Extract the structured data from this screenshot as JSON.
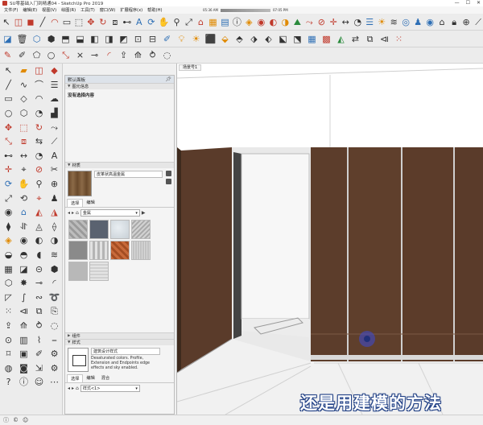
{
  "window": {
    "title": "SU零基础入门到精通04 - SketchUp Pro 2019",
    "controls": [
      "—",
      "☐",
      "✕"
    ]
  },
  "menu": [
    "文件(F)",
    "编辑(E)",
    "视图(V)",
    "绘图(R)",
    "工具(T)",
    "窗口(W)",
    "扩展程序(x)",
    "帮助(H)"
  ],
  "timebar": {
    "start": "05:36 AM",
    "end": "07:05 PM"
  },
  "toolbar": {
    "row1": [
      {
        "name": "select-icon",
        "glyph": "↖",
        "tone": ""
      },
      {
        "name": "eraser-icon",
        "glyph": "◫",
        "tone": "a"
      },
      {
        "name": "paint-bucket-icon",
        "glyph": "◼",
        "tone": "a"
      },
      {
        "name": "line-icon",
        "glyph": "╱",
        "tone": ""
      },
      {
        "name": "arc-icon",
        "glyph": "◠",
        "tone": "a"
      },
      {
        "name": "rectangle-icon",
        "glyph": "▭",
        "tone": ""
      },
      {
        "name": "push-pull-icon",
        "glyph": "⬚",
        "tone": ""
      },
      {
        "name": "move-icon",
        "glyph": "✥",
        "tone": "a"
      },
      {
        "name": "rotate-icon",
        "glyph": "↻",
        "tone": "a"
      },
      {
        "name": "offset-icon",
        "glyph": "⧈",
        "tone": ""
      },
      {
        "name": "tape-icon",
        "glyph": "⊷",
        "tone": ""
      },
      {
        "name": "text-icon",
        "glyph": "A",
        "tone": "b"
      },
      {
        "name": "orbit-icon",
        "glyph": "⟳",
        "tone": "b"
      },
      {
        "name": "pan-icon",
        "glyph": "✋",
        "tone": ""
      },
      {
        "name": "zoom-icon",
        "glyph": "⚲",
        "tone": ""
      },
      {
        "name": "zoom-extents-icon",
        "glyph": "⤢",
        "tone": ""
      },
      {
        "name": "warehouse-icon",
        "glyph": "⌂",
        "tone": "a"
      },
      {
        "name": "extension-icon",
        "glyph": "▦",
        "tone": "c"
      },
      {
        "name": "layout-icon",
        "glyph": "▤",
        "tone": "b"
      },
      {
        "name": "model-info-icon",
        "glyph": "ⓘ",
        "tone": ""
      },
      {
        "name": "solid-union-icon",
        "glyph": "◈",
        "tone": "c"
      },
      {
        "name": "solid-subtract-icon",
        "glyph": "◉",
        "tone": "a"
      },
      {
        "name": "solid-trim-icon",
        "glyph": "◐",
        "tone": "a"
      },
      {
        "name": "solid-split-icon",
        "glyph": "◑",
        "tone": "c"
      },
      {
        "name": "sandbox-icon",
        "glyph": "⛰",
        "tone": "d"
      },
      {
        "name": "follow-icon",
        "glyph": "⤳",
        "tone": "a"
      },
      {
        "name": "section-icon",
        "glyph": "⊘",
        "tone": "a"
      },
      {
        "name": "axes-icon",
        "glyph": "✛",
        "tone": "a"
      },
      {
        "name": "dimension-icon",
        "glyph": "↔",
        "tone": ""
      },
      {
        "name": "protractor-icon",
        "glyph": "◔",
        "tone": ""
      },
      {
        "name": "outliner-icon",
        "glyph": "☰",
        "tone": "b"
      },
      {
        "name": "shadow-icon",
        "glyph": "☀",
        "tone": "c"
      },
      {
        "name": "fog-icon",
        "glyph": "≋",
        "tone": ""
      },
      {
        "name": "camera-icon",
        "glyph": "◎",
        "tone": "b"
      },
      {
        "name": "walk-icon",
        "glyph": "♟",
        "tone": "b"
      },
      {
        "name": "look-icon",
        "glyph": "◉",
        "tone": "b"
      },
      {
        "name": "home-icon",
        "glyph": "⌂",
        "tone": ""
      },
      {
        "name": "lock-icon",
        "glyph": "🔒︎",
        "tone": ""
      },
      {
        "name": "unlock-icon",
        "glyph": "⊕",
        "tone": ""
      },
      {
        "name": "knife-icon",
        "glyph": "⟋",
        "tone": ""
      }
    ],
    "row2": [
      {
        "name": "hide-icon",
        "glyph": "◪",
        "tone": "b"
      },
      {
        "name": "trash-icon",
        "glyph": "🗑︎",
        "tone": ""
      },
      {
        "name": "component-icon",
        "glyph": "⬡",
        "tone": "b"
      },
      {
        "name": "group-icon",
        "glyph": "⬢",
        "tone": ""
      },
      {
        "name": "wireframe-icon",
        "glyph": "⬒",
        "tone": ""
      },
      {
        "name": "hidden-line-icon",
        "glyph": "⬓",
        "tone": ""
      },
      {
        "name": "shaded-icon",
        "glyph": "◧",
        "tone": ""
      },
      {
        "name": "textured-icon",
        "glyph": "◨",
        "tone": ""
      },
      {
        "name": "monochrome-icon",
        "glyph": "◩",
        "tone": ""
      },
      {
        "name": "xray-icon",
        "glyph": "⊡",
        "tone": ""
      },
      {
        "name": "back-edges-icon",
        "glyph": "⊟",
        "tone": ""
      },
      {
        "name": "style-icon",
        "glyph": "✐",
        "tone": "b"
      },
      {
        "name": "lamp-icon",
        "glyph": "💡︎",
        "tone": "c"
      },
      {
        "name": "sun-icon",
        "glyph": "☀",
        "tone": "c"
      },
      {
        "name": "cube-icon",
        "glyph": "⬛",
        "tone": ""
      },
      {
        "name": "iso-icon",
        "glyph": "⬙",
        "tone": "c"
      },
      {
        "name": "top-view-icon",
        "glyph": "⬘",
        "tone": ""
      },
      {
        "name": "front-view-icon",
        "glyph": "⬗",
        "tone": ""
      },
      {
        "name": "right-view-icon",
        "glyph": "⬖",
        "tone": ""
      },
      {
        "name": "back-view-icon",
        "glyph": "⬕",
        "tone": ""
      },
      {
        "name": "left-view-icon",
        "glyph": "⬔",
        "tone": ""
      },
      {
        "name": "grid-icon",
        "glyph": "▦",
        "tone": "b"
      },
      {
        "name": "brick-icon",
        "glyph": "▩",
        "tone": "a"
      },
      {
        "name": "terrain-icon",
        "glyph": "◭",
        "tone": "d"
      },
      {
        "name": "flip-icon",
        "glyph": "⇄",
        "tone": ""
      },
      {
        "name": "mirror-icon",
        "glyph": "⧉",
        "tone": ""
      },
      {
        "name": "align-icon",
        "glyph": "⧏",
        "tone": ""
      },
      {
        "name": "array-icon",
        "glyph": "⁙",
        "tone": "a"
      }
    ],
    "row3": [
      {
        "name": "draw-line-icon",
        "glyph": "✎",
        "tone": "a"
      },
      {
        "name": "freehand-icon",
        "glyph": "✐",
        "tone": ""
      },
      {
        "name": "polygon-icon",
        "glyph": "⬠",
        "tone": ""
      },
      {
        "name": "circle-icon",
        "glyph": "○",
        "tone": ""
      },
      {
        "name": "scale-icon",
        "glyph": "⤡",
        "tone": "a"
      },
      {
        "name": "intersect-icon",
        "glyph": "⨯",
        "tone": ""
      },
      {
        "name": "weld-icon",
        "glyph": "⊸",
        "tone": ""
      },
      {
        "name": "fillet-icon",
        "glyph": "◜",
        "tone": "a"
      },
      {
        "name": "extrude-icon",
        "glyph": "⇪",
        "tone": ""
      },
      {
        "name": "loft-icon",
        "glyph": "⟰",
        "tone": ""
      },
      {
        "name": "sweep-icon",
        "glyph": "⥁",
        "tone": ""
      },
      {
        "name": "shell-icon",
        "glyph": "◌",
        "tone": ""
      }
    ]
  },
  "left_tools": [
    {
      "name": "select-tool-icon",
      "glyph": "↖",
      "tone": ""
    },
    {
      "name": "paint-tool-icon",
      "glyph": "▰",
      "tone": "c"
    },
    {
      "name": "eraser-tool-icon",
      "glyph": "◫",
      "tone": "a"
    },
    {
      "name": "sketchup-logo-icon",
      "glyph": "◆",
      "tone": "a"
    },
    {
      "name": "line-tool-icon",
      "glyph": "╱",
      "tone": ""
    },
    {
      "name": "freehand-tool-icon",
      "glyph": "∿",
      "tone": ""
    },
    {
      "name": "curve-tool-icon",
      "glyph": "⌒",
      "tone": ""
    },
    {
      "name": "layers-tool-icon",
      "glyph": "☰",
      "tone": ""
    },
    {
      "name": "rectangle-tool-icon",
      "glyph": "▭",
      "tone": ""
    },
    {
      "name": "rotated-rect-tool-icon",
      "glyph": "◇",
      "tone": ""
    },
    {
      "name": "arc-tool-icon",
      "glyph": "◠",
      "tone": ""
    },
    {
      "name": "cloud-tool-icon",
      "glyph": "☁",
      "tone": ""
    },
    {
      "name": "circle-tool-icon",
      "glyph": "○",
      "tone": ""
    },
    {
      "name": "polygon-tool-icon",
      "glyph": "⬡",
      "tone": ""
    },
    {
      "name": "pie-tool-icon",
      "glyph": "◔",
      "tone": ""
    },
    {
      "name": "chart-tool-icon",
      "glyph": "▟",
      "tone": ""
    },
    {
      "name": "move-tool-icon",
      "glyph": "✥",
      "tone": "a"
    },
    {
      "name": "push-tool-icon",
      "glyph": "⬚",
      "tone": "a"
    },
    {
      "name": "rotate-tool-icon",
      "glyph": "↻",
      "tone": "a"
    },
    {
      "name": "follow-tool-icon",
      "glyph": "⤳",
      "tone": ""
    },
    {
      "name": "scale-tool-icon",
      "glyph": "⤡",
      "tone": "a"
    },
    {
      "name": "offset-tool-icon",
      "glyph": "⧈",
      "tone": "a"
    },
    {
      "name": "flip-tool-icon",
      "glyph": "⇆",
      "tone": ""
    },
    {
      "name": "tilt-tool-icon",
      "glyph": "⟋",
      "tone": ""
    },
    {
      "name": "tape-tool-icon",
      "glyph": "⊷",
      "tone": ""
    },
    {
      "name": "dimension-tool-icon",
      "glyph": "↔",
      "tone": ""
    },
    {
      "name": "protractor-tool-icon",
      "glyph": "◔",
      "tone": ""
    },
    {
      "name": "text-tool-icon",
      "glyph": "A",
      "tone": ""
    },
    {
      "name": "axes-tool-icon",
      "glyph": "✛",
      "tone": "a"
    },
    {
      "name": "label-tool-icon",
      "glyph": "⌖",
      "tone": ""
    },
    {
      "name": "section-tool-icon",
      "glyph": "⊘",
      "tone": "a"
    },
    {
      "name": "cut-tool-icon",
      "glyph": "✂",
      "tone": ""
    },
    {
      "name": "orbit-tool-icon",
      "glyph": "⟳",
      "tone": "b"
    },
    {
      "name": "pan-tool-icon",
      "glyph": "✋",
      "tone": ""
    },
    {
      "name": "zoom-tool-icon",
      "glyph": "⚲",
      "tone": ""
    },
    {
      "name": "zoom-window-tool-icon",
      "glyph": "⊕",
      "tone": ""
    },
    {
      "name": "zoom-extents-tool-icon",
      "glyph": "⤢",
      "tone": ""
    },
    {
      "name": "prev-view-tool-icon",
      "glyph": "⟲",
      "tone": ""
    },
    {
      "name": "position-camera-tool-icon",
      "glyph": "⌖",
      "tone": "a"
    },
    {
      "name": "walk-tool-icon",
      "glyph": "♟",
      "tone": ""
    },
    {
      "name": "look-tool-icon",
      "glyph": "◉",
      "tone": ""
    },
    {
      "name": "warehouse-tool-icon",
      "glyph": "⌂",
      "tone": "b"
    },
    {
      "name": "sandbox-tool-icon",
      "glyph": "◭",
      "tone": "a"
    },
    {
      "name": "sandbox-smoove-icon",
      "glyph": "◮",
      "tone": "a"
    },
    {
      "name": "stamp-tool-icon",
      "glyph": "⧫",
      "tone": ""
    },
    {
      "name": "drape-tool-icon",
      "glyph": "⥯",
      "tone": ""
    },
    {
      "name": "detail-tool-icon",
      "glyph": "◬",
      "tone": ""
    },
    {
      "name": "flip-edge-tool-icon",
      "glyph": "⟠",
      "tone": ""
    },
    {
      "name": "union-tool-icon",
      "glyph": "◈",
      "tone": "c"
    },
    {
      "name": "subtract-tool-icon",
      "glyph": "◉",
      "tone": ""
    },
    {
      "name": "trim-tool-icon",
      "glyph": "◐",
      "tone": ""
    },
    {
      "name": "intersect-tool-icon",
      "glyph": "◑",
      "tone": ""
    },
    {
      "name": "split-tool-icon",
      "glyph": "◒",
      "tone": ""
    },
    {
      "name": "outer-shell-tool-icon",
      "glyph": "◓",
      "tone": ""
    },
    {
      "name": "shadow-tool-icon",
      "glyph": "◖",
      "tone": ""
    },
    {
      "name": "fog-tool-icon",
      "glyph": "≋",
      "tone": ""
    },
    {
      "name": "grid-tool-icon",
      "glyph": "▦",
      "tone": ""
    },
    {
      "name": "hide-tool-icon",
      "glyph": "◪",
      "tone": ""
    },
    {
      "name": "lock-tool-icon",
      "glyph": "⊝",
      "tone": ""
    },
    {
      "name": "group-tool-icon",
      "glyph": "⬢",
      "tone": ""
    },
    {
      "name": "component-tool-icon",
      "glyph": "⬡",
      "tone": ""
    },
    {
      "name": "explode-tool-icon",
      "glyph": "✸",
      "tone": ""
    },
    {
      "name": "weld-tool-icon",
      "glyph": "⊸",
      "tone": ""
    },
    {
      "name": "fillet-tool-icon",
      "glyph": "◜",
      "tone": ""
    },
    {
      "name": "chamfer-tool-icon",
      "glyph": "◸",
      "tone": ""
    },
    {
      "name": "bezier-tool-icon",
      "glyph": "∫",
      "tone": ""
    },
    {
      "name": "spline-tool-icon",
      "glyph": "∾",
      "tone": ""
    },
    {
      "name": "helix-tool-icon",
      "glyph": "➰",
      "tone": ""
    },
    {
      "name": "array-tool-icon",
      "glyph": "⁙",
      "tone": ""
    },
    {
      "name": "align-tool-icon",
      "glyph": "⧏",
      "tone": ""
    },
    {
      "name": "mirror-tool-icon",
      "glyph": "⧉",
      "tone": ""
    },
    {
      "name": "paste-tool-icon",
      "glyph": "⎘",
      "tone": ""
    },
    {
      "name": "extrude-tool-icon",
      "glyph": "⇪",
      "tone": ""
    },
    {
      "name": "loft-tool-icon",
      "glyph": "⟰",
      "tone": ""
    },
    {
      "name": "sweep-tool-icon",
      "glyph": "⥁",
      "tone": ""
    },
    {
      "name": "shell-tool-icon",
      "glyph": "◌",
      "tone": ""
    },
    {
      "name": "hole-tool-icon",
      "glyph": "⊙",
      "tone": ""
    },
    {
      "name": "thicken-tool-icon",
      "glyph": "▥",
      "tone": ""
    },
    {
      "name": "curve-stitch-tool-icon",
      "glyph": "⌇",
      "tone": ""
    },
    {
      "name": "edge-tool-icon",
      "glyph": "⎯",
      "tone": ""
    },
    {
      "name": "tag-tool-icon",
      "glyph": "⌑",
      "tone": ""
    },
    {
      "name": "scene-tool-icon",
      "glyph": "▣",
      "tone": ""
    },
    {
      "name": "style-tool-icon",
      "glyph": "✐",
      "tone": ""
    },
    {
      "name": "plugin-tool-icon",
      "glyph": "⚙",
      "tone": ""
    },
    {
      "name": "render-tool-icon",
      "glyph": "◍",
      "tone": ""
    },
    {
      "name": "photo-tool-icon",
      "glyph": "◙",
      "tone": ""
    },
    {
      "name": "export-tool-icon",
      "glyph": "⇲",
      "tone": ""
    },
    {
      "name": "settings-tool-icon",
      "glyph": "⚙",
      "tone": ""
    },
    {
      "name": "help-tool-icon",
      "glyph": "?",
      "tone": ""
    },
    {
      "name": "info-tool-icon",
      "glyph": "ⓘ",
      "tone": ""
    },
    {
      "name": "user-tool-icon",
      "glyph": "☺",
      "tone": ""
    },
    {
      "name": "more-tool-icon",
      "glyph": "⋯",
      "tone": ""
    }
  ],
  "tray": {
    "title": "默认面板",
    "entity_info": {
      "label": "图元信息",
      "content": "没有选择内容"
    },
    "materials": {
      "label": "材质",
      "current": "皮革状高温金属",
      "tabs": [
        "选择",
        "编辑"
      ],
      "library": "金属"
    },
    "components": {
      "label": "组件"
    },
    "styles": {
      "label": "样式",
      "name": "建筑设计样式",
      "description": "Desaturated colors. Profile, Extension and Endpoints edge effects and sky enabled.",
      "tabs": [
        "选择",
        "编辑",
        "混合"
      ],
      "library": "样式<1>"
    }
  },
  "viewport": {
    "scene_tab": "场景号1",
    "subtitle": "还是用建模的方法"
  }
}
